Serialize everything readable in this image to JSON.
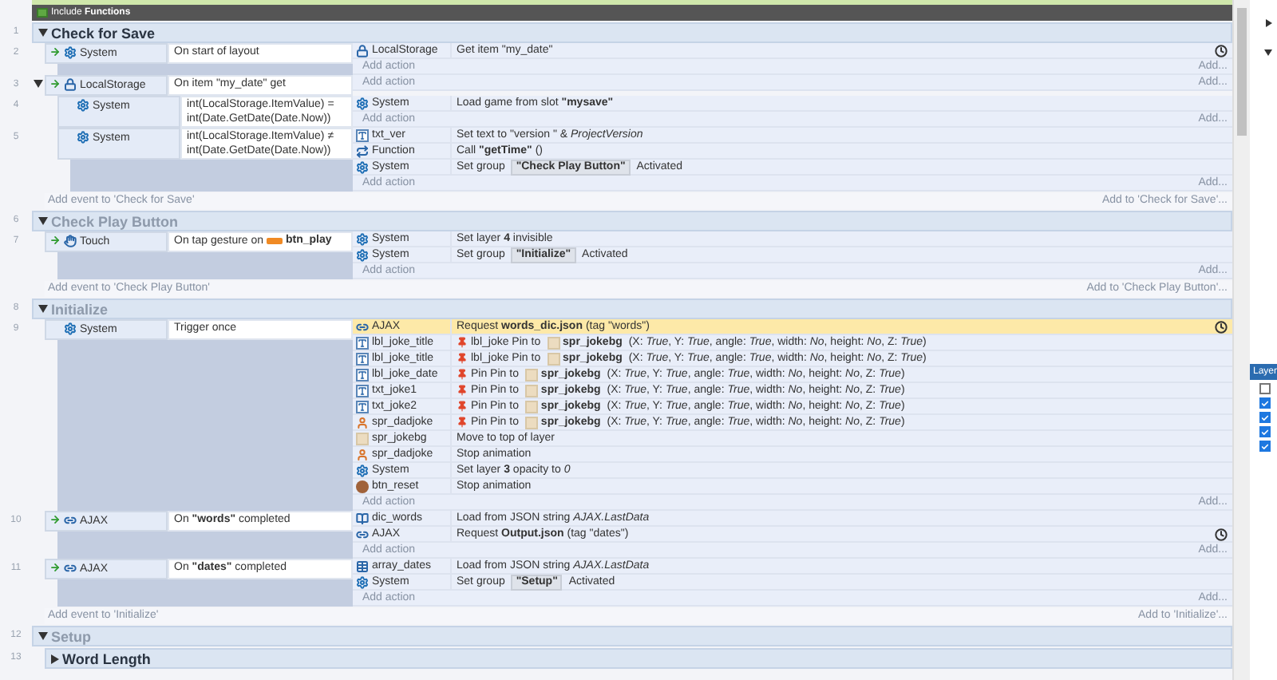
{
  "include": {
    "text": "Include **Functions**"
  },
  "groups": [
    {
      "line": "1",
      "title": "Check for Save",
      "active": true,
      "expanded": true,
      "add_event": "Add event to 'Check for Save'",
      "add_to": "Add to 'Check for Save'...",
      "events": [
        {
          "line": "2",
          "trigger": true,
          "kind": "system",
          "object": "System",
          "condition": [
            {
              "kind": "text",
              "text": "On start of layout"
            }
          ],
          "add_action": "Add action",
          "add_more": "Add...",
          "actions": [
            {
              "kind": "storage",
              "object": "LocalStorage",
              "parts": [
                {
                  "kind": "text",
                  "text": "Get item \"my_date\""
                }
              ],
              "async": true,
              "selected": false
            }
          ]
        },
        {
          "line": "3",
          "trigger": true,
          "expanded": true,
          "kind": "storage",
          "object": "LocalStorage",
          "condition": [
            {
              "kind": "text",
              "text": "On item \"my_date\" get"
            }
          ],
          "add_action": "Add action",
          "add_more": "Add...",
          "children": [
            {
              "line": "4",
              "trigger": false,
              "kind": "system",
              "object": "System",
              "condition": [
                {
                  "kind": "text",
                  "text": "int(LocalStorage.ItemValue) = int(Date.GetDate(Date.Now))"
                }
              ],
              "add_action": "Add action",
              "add_more": "Add...",
              "actions": [
                {
                  "kind": "system",
                  "object": "System",
                  "parts": [
                    {
                      "kind": "text",
                      "text": "Load game from slot **\"mysave\"**"
                    }
                  ],
                  "async": false,
                  "selected": false
                }
              ]
            },
            {
              "line": "5",
              "trigger": false,
              "kind": "system",
              "object": "System",
              "condition": [
                {
                  "kind": "text",
                  "text": "int(LocalStorage.ItemValue) ≠ int(Date.GetDate(Date.Now))"
                }
              ],
              "add_action": "Add action",
              "add_more": "Add...",
              "actions": [
                {
                  "kind": "text",
                  "object": "txt_ver",
                  "parts": [
                    {
                      "kind": "text",
                      "text": "Set text to \"version \" & *ProjectVersion*"
                    }
                  ],
                  "async": false,
                  "selected": false
                },
                {
                  "kind": "function",
                  "object": "Function",
                  "parts": [
                    {
                      "kind": "text",
                      "text": "Call **\"getTime\"** ()"
                    }
                  ],
                  "async": false,
                  "selected": false
                },
                {
                  "kind": "system",
                  "object": "System",
                  "parts": [
                    {
                      "kind": "text",
                      "text": "Set group "
                    },
                    {
                      "kind": "chip",
                      "text": "\"Check Play Button\""
                    },
                    {
                      "kind": "text",
                      "text": " Activated"
                    }
                  ],
                  "async": false,
                  "selected": false
                }
              ]
            }
          ]
        }
      ]
    },
    {
      "line": "6",
      "title": "Check Play Button",
      "active": false,
      "expanded": true,
      "add_event": "Add event to 'Check Play Button'",
      "add_to": "Add to 'Check Play Button'...",
      "events": [
        {
          "line": "7",
          "trigger": true,
          "kind": "touch",
          "object": "Touch",
          "condition": [
            {
              "kind": "text",
              "text": "On tap gesture on "
            },
            {
              "kind": "button_ref",
              "text": "btn_play"
            }
          ],
          "add_action": "Add action",
          "add_more": "Add...",
          "actions": [
            {
              "kind": "system",
              "object": "System",
              "parts": [
                {
                  "kind": "text",
                  "text": "Set layer **4** invisible"
                }
              ],
              "async": false,
              "selected": false
            },
            {
              "kind": "system",
              "object": "System",
              "parts": [
                {
                  "kind": "text",
                  "text": "Set group "
                },
                {
                  "kind": "chip",
                  "text": "\"Initialize\""
                },
                {
                  "kind": "text",
                  "text": " Activated"
                }
              ],
              "async": false,
              "selected": false
            }
          ]
        }
      ]
    },
    {
      "line": "8",
      "title": "Initialize",
      "active": false,
      "expanded": true,
      "add_event": "Add event to 'Initialize'",
      "add_to": "Add to 'Initialize'...",
      "events": [
        {
          "line": "9",
          "trigger": false,
          "kind": "system",
          "object": "System",
          "condition": [
            {
              "kind": "text",
              "text": "Trigger once"
            }
          ],
          "add_action": "Add action",
          "add_more": "Add...",
          "actions": [
            {
              "kind": "ajax",
              "object": "AJAX",
              "parts": [
                {
                  "kind": "text",
                  "text": "Request **words_dic.json** (tag \"words\")"
                }
              ],
              "async": true,
              "selected": true
            },
            {
              "kind": "text",
              "object": "lbl_joke_title",
              "parts": [
                {
                  "kind": "pin"
                },
                {
                  "kind": "text",
                  "text": "lbl_joke Pin to "
                },
                {
                  "kind": "sprite_ref",
                  "text": "spr_jokebg"
                },
                {
                  "kind": "text",
                  "text": " (X: *True*, Y: *True*, angle: *True*, width: *No*, height: *No*, Z: *True*)"
                }
              ],
              "async": false,
              "selected": false
            },
            {
              "kind": "text",
              "object": "lbl_joke_title",
              "parts": [
                {
                  "kind": "pin"
                },
                {
                  "kind": "text",
                  "text": "lbl_joke Pin to "
                },
                {
                  "kind": "sprite_ref",
                  "text": "spr_jokebg"
                },
                {
                  "kind": "text",
                  "text": " (X: *True*, Y: *True*, angle: *True*, width: *No*, height: *No*, Z: *True*)"
                }
              ],
              "async": false,
              "selected": false
            },
            {
              "kind": "text",
              "object": "lbl_joke_date",
              "parts": [
                {
                  "kind": "pin"
                },
                {
                  "kind": "text",
                  "text": "Pin Pin to "
                },
                {
                  "kind": "sprite_ref",
                  "text": "spr_jokebg"
                },
                {
                  "kind": "text",
                  "text": " (X: *True*, Y: *True*, angle: *True*, width: *No*, height: *No*, Z: *True*)"
                }
              ],
              "async": false,
              "selected": false
            },
            {
              "kind": "text",
              "object": "txt_joke1",
              "parts": [
                {
                  "kind": "pin"
                },
                {
                  "kind": "text",
                  "text": "Pin Pin to "
                },
                {
                  "kind": "sprite_ref",
                  "text": "spr_jokebg"
                },
                {
                  "kind": "text",
                  "text": " (X: *True*, Y: *True*, angle: *True*, width: *No*, height: *No*, Z: *True*)"
                }
              ],
              "async": false,
              "selected": false
            },
            {
              "kind": "text",
              "object": "txt_joke2",
              "parts": [
                {
                  "kind": "pin"
                },
                {
                  "kind": "text",
                  "text": "Pin Pin to "
                },
                {
                  "kind": "sprite_ref",
                  "text": "spr_jokebg"
                },
                {
                  "kind": "text",
                  "text": " (X: *True*, Y: *True*, angle: *True*, width: *No*, height: *No*, Z: *True*)"
                }
              ],
              "async": false,
              "selected": false
            },
            {
              "kind": "sprite_person",
              "object": "spr_dadjoke",
              "parts": [
                {
                  "kind": "pin"
                },
                {
                  "kind": "text",
                  "text": "Pin Pin to "
                },
                {
                  "kind": "sprite_ref",
                  "text": "spr_jokebg"
                },
                {
                  "kind": "text",
                  "text": " (X: *True*, Y: *True*, angle: *True*, width: *No*, height: *No*, Z: *True*)"
                }
              ],
              "async": false,
              "selected": false
            },
            {
              "kind": "sprite_tan",
              "object": "spr_jokebg",
              "parts": [
                {
                  "kind": "text",
                  "text": "Move to top of layer"
                }
              ],
              "async": false,
              "selected": false
            },
            {
              "kind": "sprite_person",
              "object": "spr_dadjoke",
              "parts": [
                {
                  "kind": "text",
                  "text": "Stop animation"
                }
              ],
              "async": false,
              "selected": false
            },
            {
              "kind": "system",
              "object": "System",
              "parts": [
                {
                  "kind": "text",
                  "text": "Set layer **3** opacity to *0*"
                }
              ],
              "async": false,
              "selected": false
            },
            {
              "kind": "button_round",
              "object": "btn_reset",
              "parts": [
                {
                  "kind": "text",
                  "text": "Stop animation"
                }
              ],
              "async": false,
              "selected": false
            }
          ]
        },
        {
          "line": "10",
          "trigger": true,
          "kind": "ajax",
          "object": "AJAX",
          "condition": [
            {
              "kind": "text",
              "text": "On **\"words\"** completed"
            }
          ],
          "actions": [
            {
              "kind": "dictionary",
              "object": "dic_words",
              "parts": [
                {
                  "kind": "text",
                  "text": "Load from JSON string *AJAX.LastData*"
                }
              ],
              "async": false,
              "selected": false
            },
            {
              "kind": "ajax",
              "object": "AJAX",
              "parts": [
                {
                  "kind": "text",
                  "text": "Request **Output.json** (tag \"dates\")"
                }
              ],
              "async": true,
              "selected": false
            }
          ],
          "add_action": "Add action",
          "add_more": "Add..."
        },
        {
          "line": "11",
          "trigger": true,
          "kind": "ajax",
          "object": "AJAX",
          "condition": [
            {
              "kind": "text",
              "text": "On **\"dates\"** completed"
            }
          ],
          "actions": [
            {
              "kind": "array",
              "object": "array_dates",
              "parts": [
                {
                  "kind": "text",
                  "text": "Load from JSON string *AJAX.LastData*"
                }
              ],
              "async": false,
              "selected": false
            },
            {
              "kind": "system",
              "object": "System",
              "parts": [
                {
                  "kind": "text",
                  "text": "Set group "
                },
                {
                  "kind": "chip",
                  "text": "\"Setup\""
                },
                {
                  "kind": "text",
                  "text": " Activated"
                }
              ],
              "async": false,
              "selected": false
            }
          ],
          "add_action": "Add action",
          "add_more": "Add..."
        }
      ]
    },
    {
      "line": "12",
      "title": "Setup",
      "active": false,
      "expanded": true,
      "children": [
        {
          "line": "13",
          "title": "Word Length",
          "active": true,
          "expanded": false
        }
      ]
    }
  ],
  "right_panel": {
    "layers_title": "Layer",
    "layers": [
      {
        "checked": false
      },
      {
        "checked": true
      },
      {
        "checked": true
      },
      {
        "checked": true
      },
      {
        "checked": true
      }
    ]
  }
}
